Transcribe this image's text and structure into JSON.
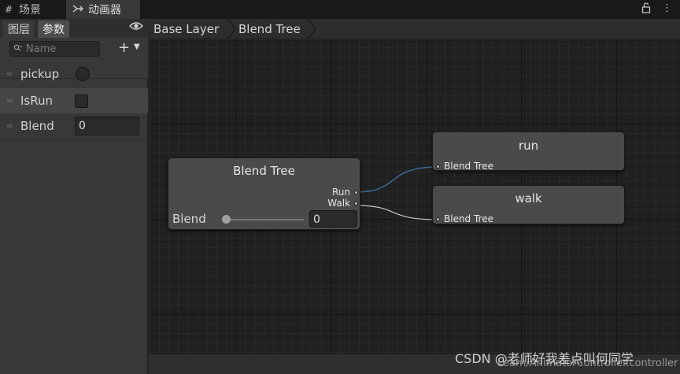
{
  "tabs": {
    "scene": {
      "icon": "#",
      "label": "场景"
    },
    "animator": {
      "icon": "Ⲅ",
      "label": "动画器"
    }
  },
  "toolbar": {
    "lock_glyph": "🔓",
    "menu_glyph": "⋮"
  },
  "left_panel": {
    "subtabs": {
      "layers": "图层",
      "parameters": "参数"
    },
    "search": {
      "placeholder": "Name"
    },
    "add_glyph": "+",
    "parameters": [
      {
        "name": "pickup",
        "type": "trigger"
      },
      {
        "name": "IsRun",
        "type": "bool"
      },
      {
        "name": "Blend",
        "type": "float",
        "value": "0"
      }
    ]
  },
  "breadcrumb": {
    "items": [
      "Base Layer",
      "Blend Tree"
    ]
  },
  "graph": {
    "blend_tree_node": {
      "title": "Blend Tree",
      "outputs": [
        "Run",
        "Walk"
      ],
      "param_label": "Blend",
      "param_value": "0",
      "slider_fraction": 0
    },
    "motion_nodes": [
      {
        "title": "run",
        "input_label": "Blend Tree"
      },
      {
        "title": "walk",
        "input_label": "Blend Tree"
      }
    ]
  },
  "colors": {
    "wire_run": "#3b6a94",
    "wire_walk": "#c8c8c8",
    "panel_bg": "#383838",
    "graph_bg": "#202020"
  },
  "footer": {
    "path": "Learn/AnimatorController.controller",
    "watermark": "CSDN @老师好我差点叫何同学"
  }
}
